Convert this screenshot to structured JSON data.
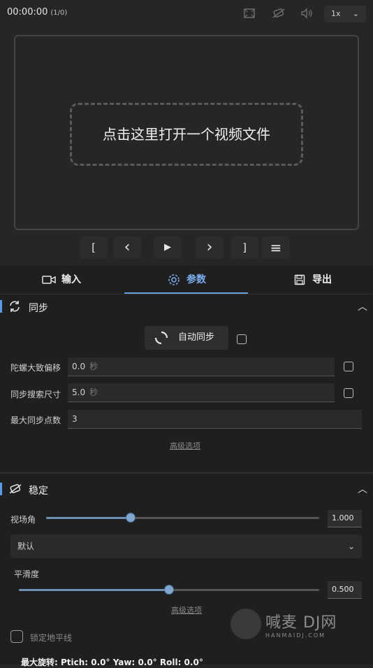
{
  "player": {
    "time": "00:00:00",
    "frame": "(1/0)",
    "speed": "1x",
    "drop_text": "点击这里打开一个视频文件"
  },
  "controls": {
    "mark_in": "[",
    "prev": "‹",
    "play": "▶",
    "next": "›",
    "mark_out": "]",
    "menu": "≡"
  },
  "tabs": [
    {
      "label": "输入",
      "icon": "video-camera-icon"
    },
    {
      "label": "参数",
      "icon": "gear-icon",
      "active": true
    },
    {
      "label": "导出",
      "icon": "save-icon"
    }
  ],
  "sync": {
    "title": "同步",
    "auto_sync_label": "自动同步",
    "gyro_offset_label": "陀螺大致偏移",
    "gyro_offset_value": "0.0",
    "gyro_offset_unit": "秒",
    "search_size_label": "同步搜索尺寸",
    "search_size_value": "5.0",
    "search_size_unit": "秒",
    "max_points_label": "最大同步点数",
    "max_points_value": "3",
    "advanced_link": "高级选项"
  },
  "stabilization": {
    "title": "稳定",
    "fov_label": "视场角",
    "fov_value": "1.000",
    "fov_fraction": 0.31,
    "method_value": "默认",
    "smoothness_label": "平滑度",
    "smoothness_value": "0.500",
    "smoothness_fraction": 0.5,
    "advanced_link": "高级选项",
    "lock_horizon_label": "锁定地平线",
    "max_rotation_label": "最大旋转: Ptich: 0.0° Yaw: 0.0° Roll: 0.0°"
  },
  "watermark": {
    "text_big": "喊麦 DJ网",
    "text_small": "HANMAIDJ.COM"
  }
}
